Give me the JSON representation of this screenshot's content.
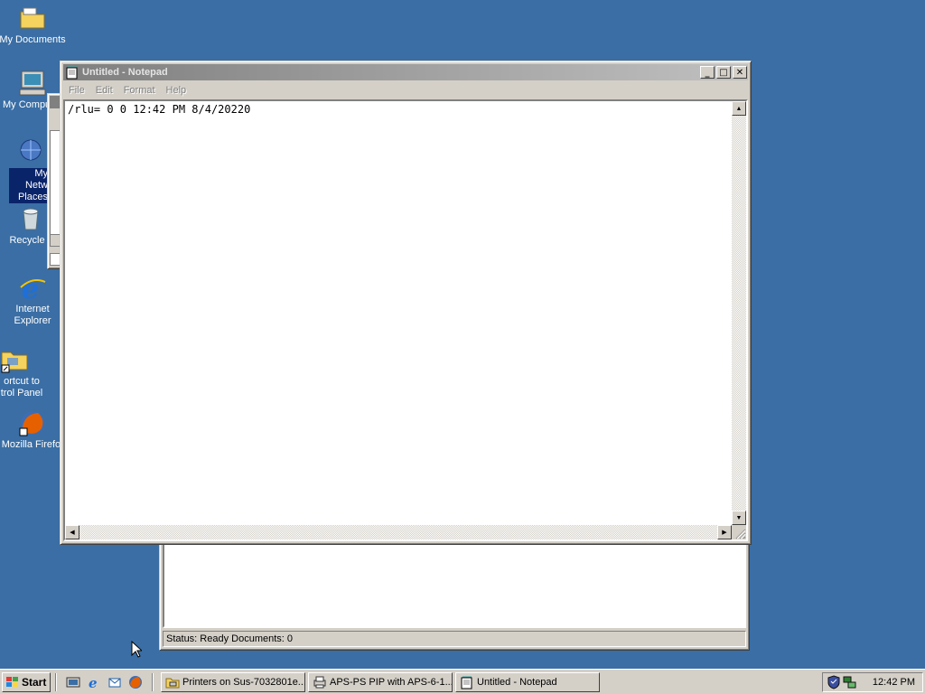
{
  "desktop": {
    "icons": [
      {
        "label": "My Documents"
      },
      {
        "label": "My Compu"
      },
      {
        "label": "My Netw Places"
      },
      {
        "label": "Recycle"
      },
      {
        "label": "Internet Explorer"
      },
      {
        "label": "ortcut to trol Panel"
      },
      {
        "label": "Mozilla Firefo:"
      }
    ]
  },
  "printers_window": {
    "status": "Status: Ready Documents: 0"
  },
  "notepad": {
    "title": "Untitled - Notepad",
    "menu": [
      "File",
      "Edit",
      "Format",
      "Help"
    ],
    "content": "/rlu= 0 0 12:42 PM 8/4/20220"
  },
  "taskbar": {
    "start_label": "Start",
    "tasks": [
      {
        "label": "Printers on Sus-7032801e..."
      },
      {
        "label": "APS-PS PIP with APS-6-1..."
      },
      {
        "label": "Untitled - Notepad"
      }
    ],
    "clock": "12:42 PM"
  }
}
